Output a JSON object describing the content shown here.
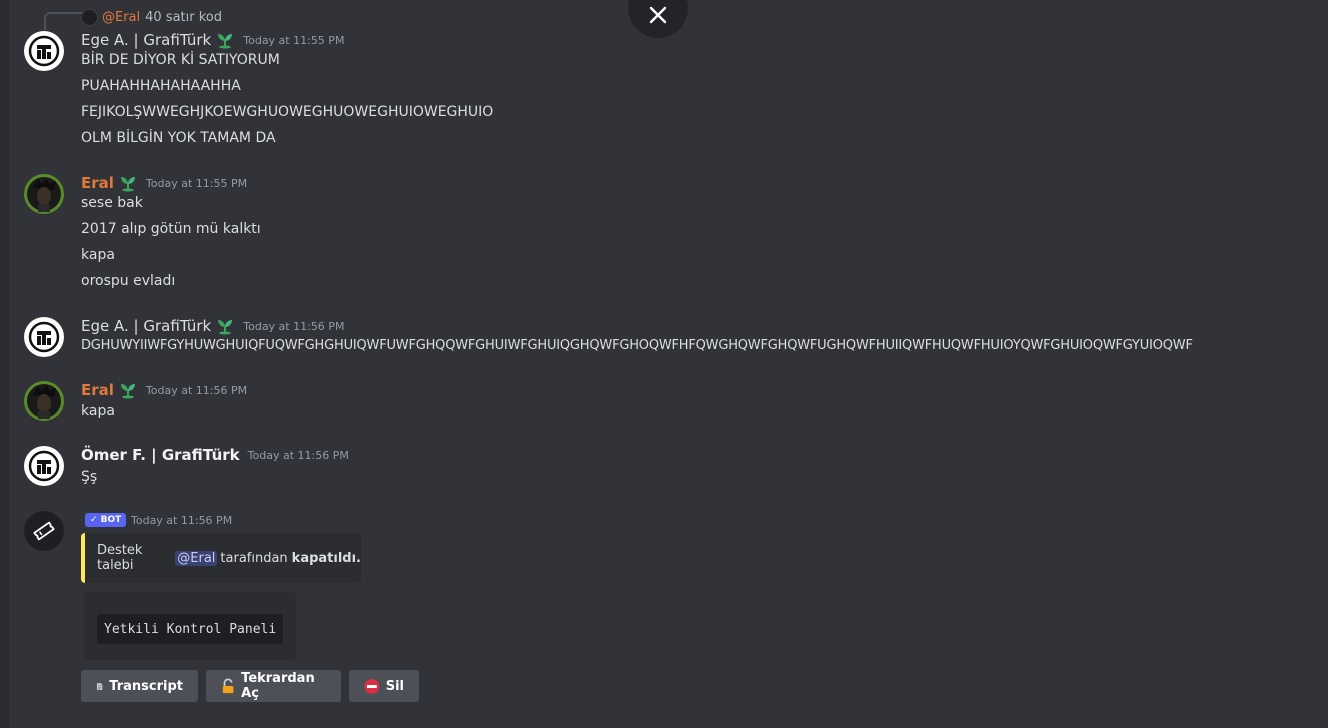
{
  "reply": {
    "mention": "@Eral",
    "text": "40 satır kod"
  },
  "messages": [
    {
      "author": "Ege A. | GrafiTürk",
      "timestamp": "Today at 11:55 PM",
      "lines": [
        "BİR DE DİYOR Kİ SATIYORUM",
        "PUAHAHHAHAHAAHHA",
        "FEJIKOLŞWWEGHJKOEWGHUOWEGHUOWEGHUIOWEGHUIO",
        "OLM BİLGİN YOK TAMAM DA"
      ]
    },
    {
      "author": "Eral",
      "timestamp": "Today at 11:55 PM",
      "lines": [
        "sese bak",
        "2017 alıp götün mü kalktı",
        "kapa",
        "orospu evladı"
      ]
    },
    {
      "author": "Ege A. | GrafiTürk",
      "timestamp": "Today at 11:56 PM",
      "lines": [
        "DGHUWYIIWFGYHUWGHUIQFUQWFGHGHUIQWFUWFGHQQWFGHUIWFGHUIQGHQWFGHOQWFHFQWGHQWFGHQWFUGHQWFHUIIQWFHUQWFHUIOYQWFGHUIOQWFGYUIOQWF"
      ]
    },
    {
      "author": "Eral",
      "timestamp": "Today at 11:56 PM",
      "lines": [
        "kapa"
      ]
    },
    {
      "author": "Ömer F. | GrafiTürk",
      "timestamp": "Today at 11:56 PM",
      "lines": [
        "Şş"
      ]
    }
  ],
  "bot": {
    "tag": "✓ BOT",
    "timestamp": "Today at 11:56 PM",
    "embed": {
      "prefix": "Destek talebi",
      "mention": "@Eral",
      "middle": "tarafından",
      "bold": "kapatıldı."
    },
    "panel_label": "Yetkili Kontrol Paneli",
    "buttons": {
      "transcript": "Transcript",
      "reopen": "Tekrardan Aç",
      "delete": "Sil"
    }
  },
  "colors": {
    "background": "#313338",
    "eral": "#e0793a",
    "embed_accent": "#fee75c",
    "bot_tag": "#5865f2",
    "button": "#4e5058"
  }
}
